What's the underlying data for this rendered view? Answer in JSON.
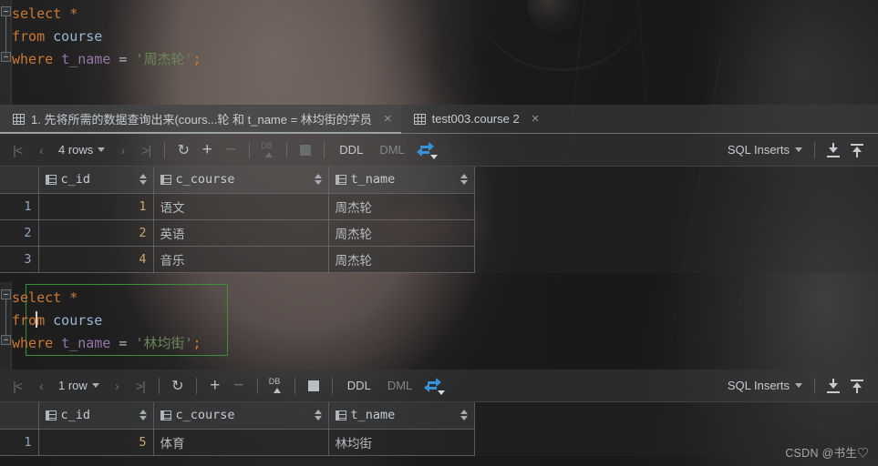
{
  "editor1": {
    "lines": [
      {
        "tokens": [
          {
            "t": "select",
            "c": "kw"
          },
          {
            "t": " ",
            "c": "op"
          },
          {
            "t": "*",
            "c": "kw"
          }
        ]
      },
      {
        "tokens": [
          {
            "t": "from",
            "c": "kw"
          },
          {
            "t": " ",
            "c": "op"
          },
          {
            "t": "course",
            "c": "tbl"
          }
        ]
      },
      {
        "tokens": [
          {
            "t": "where",
            "c": "kw"
          },
          {
            "t": " ",
            "c": "op"
          },
          {
            "t": "t_name",
            "c": "col"
          },
          {
            "t": " = ",
            "c": "op"
          },
          {
            "t": "'周杰轮'",
            "c": "str"
          },
          {
            "t": ";",
            "c": "semi"
          }
        ]
      }
    ]
  },
  "editor2": {
    "lines": [
      {
        "tokens": [
          {
            "t": "select",
            "c": "kw"
          },
          {
            "t": " ",
            "c": "op"
          },
          {
            "t": "*",
            "c": "kw"
          }
        ]
      },
      {
        "tokens": [
          {
            "t": "from",
            "c": "kw"
          },
          {
            "t": " ",
            "c": "op"
          },
          {
            "t": "course",
            "c": "tbl"
          }
        ]
      },
      {
        "tokens": [
          {
            "t": "where",
            "c": "kw"
          },
          {
            "t": " ",
            "c": "op"
          },
          {
            "t": "t_name",
            "c": "col"
          },
          {
            "t": " = ",
            "c": "op"
          },
          {
            "t": "'林均街'",
            "c": "str"
          },
          {
            "t": ";",
            "c": "semi"
          }
        ]
      }
    ],
    "selection_color": "#3a8f3a"
  },
  "panel1": {
    "tabs": [
      {
        "label": "1. 先将所需的数据查询出来(cours...轮 和 t_name = 林均街的学员",
        "active": true,
        "close": "×",
        "icon": "grid-icon"
      },
      {
        "label": "test003.course 2",
        "active": false,
        "close": "×",
        "icon": "grid-icon"
      }
    ],
    "toolbar": {
      "first_page": "|<",
      "prev_page": "‹",
      "rows_label": "4 rows",
      "next_page": "›",
      "last_page": ">|",
      "refresh": "↻",
      "add_row": "+",
      "remove_row": "−",
      "db_submit": "DB",
      "stop": "stop",
      "ddl": "DDL",
      "dml": "DML",
      "transpose": "transpose",
      "export_format": "SQL Inserts",
      "download": "download",
      "upload": "upload"
    },
    "grid": {
      "columns": [
        "",
        "c_id",
        "c_course",
        "t_name"
      ],
      "rows": [
        {
          "n": "1",
          "c_id": "1",
          "c_course": "语文",
          "t_name": "周杰轮"
        },
        {
          "n": "2",
          "c_id": "2",
          "c_course": "英语",
          "t_name": "周杰轮"
        },
        {
          "n": "3",
          "c_id": "4",
          "c_course": "音乐",
          "t_name": "周杰轮"
        }
      ]
    }
  },
  "panel2": {
    "toolbar": {
      "first_page": "|<",
      "prev_page": "‹",
      "rows_label": "1 row",
      "next_page": "›",
      "last_page": ">|",
      "refresh": "↻",
      "add_row": "+",
      "remove_row": "−",
      "db_submit": "DB",
      "stop": "stop",
      "ddl": "DDL",
      "dml": "DML",
      "transpose": "transpose",
      "export_format": "SQL Inserts",
      "download": "download",
      "upload": "upload"
    },
    "grid": {
      "columns": [
        "",
        "c_id",
        "c_course",
        "t_name"
      ],
      "rows": [
        {
          "n": "1",
          "c_id": "5",
          "c_course": "体育",
          "t_name": "林均街"
        }
      ]
    }
  },
  "watermark": "CSDN @书生♡",
  "colors": {
    "keyword": "#cc7832",
    "string": "#6a8759",
    "column": "#9876aa",
    "table": "#9bb5d6",
    "accent_blue": "#3592d6",
    "selection_border": "#3a8f3a",
    "number_cell": "#c9a870"
  }
}
